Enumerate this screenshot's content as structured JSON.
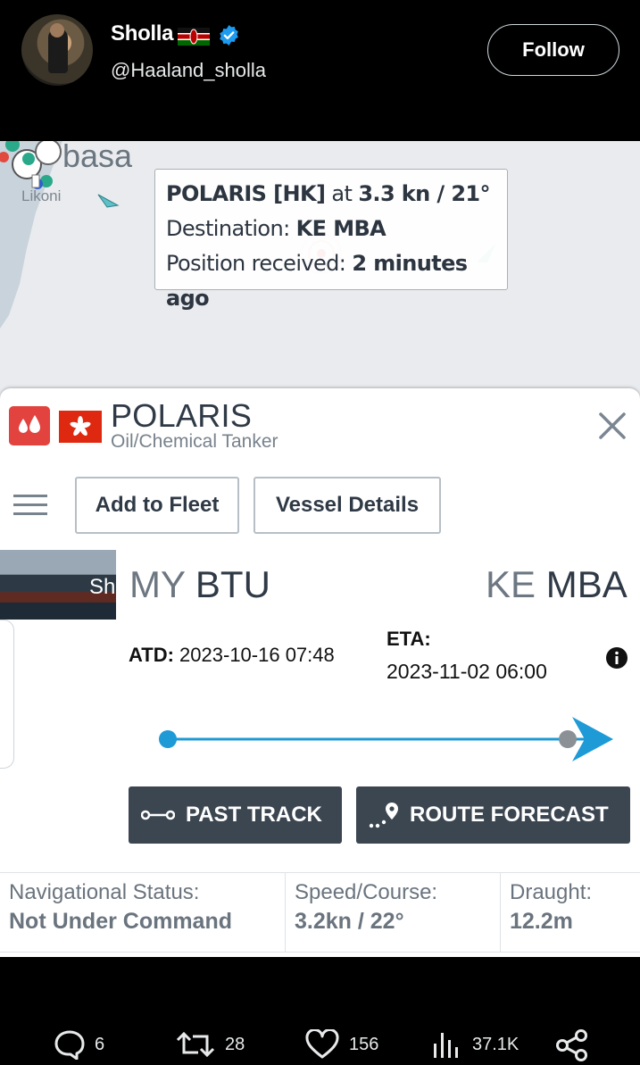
{
  "header": {
    "display_name": "Sholla",
    "handle": "@Haaland_sholla",
    "follow_label": "Follow"
  },
  "map": {
    "city_label": "basa",
    "likoni_label": "Likoni",
    "tooltip": {
      "vessel": "POLARIS [HK]",
      "at": "at",
      "speed_course": "3.3 kn / 21°",
      "destination_label": "Destination:",
      "destination": "KE MBA",
      "position_label": "Position received:",
      "position_time": "2 minutes ago"
    }
  },
  "vessel": {
    "name": "POLARIS",
    "type": "Oil/Chemical Tanker",
    "add_fleet_label": "Add to Fleet",
    "details_label": "Vessel Details",
    "photo_text": "Sh",
    "origin_country": "MY",
    "origin_port": "BTU",
    "dest_country": "KE",
    "dest_port": "MBA",
    "atd_label": "ATD:",
    "atd_value": "2023-10-16 07:48",
    "eta_label": "ETA:",
    "eta_value": "2023-11-02 06:00",
    "voyage_progress": 0.92,
    "past_track_label": "PAST TRACK",
    "route_forecast_label": "ROUTE FORECAST",
    "stats": [
      {
        "label": "Navigational Status:",
        "value": "Not Under Command"
      },
      {
        "label": "Speed/Course:",
        "value": "3.2kn / 22°"
      },
      {
        "label": "Draught:",
        "value": "12.2m"
      }
    ],
    "colors": {
      "accent": "#1e9ad6",
      "type_icon": "#e2433f",
      "dark_button": "#3c4651"
    }
  },
  "actions": {
    "replies": "6",
    "retweets": "28",
    "likes": "156",
    "views": "37.1K"
  }
}
